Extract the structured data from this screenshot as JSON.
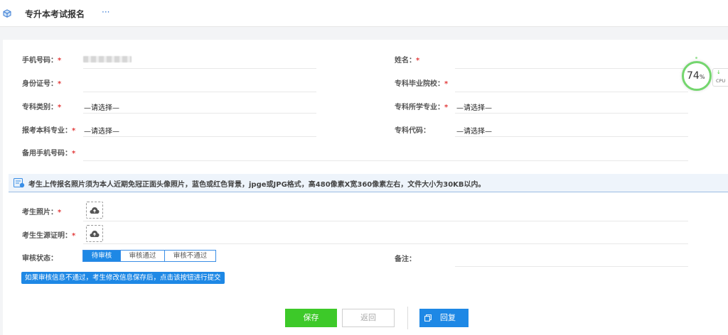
{
  "header": {
    "title": "专升本考试报名",
    "more_label": "···",
    "app_icon": "cube-icon"
  },
  "form": {
    "phone": {
      "label": "手机号码：",
      "required": "*"
    },
    "name": {
      "label": "姓名：",
      "required": "*",
      "value": ""
    },
    "id_number": {
      "label": "身份证号：",
      "required": "*",
      "value": ""
    },
    "college": {
      "label": "专科毕业院校：",
      "required": "*",
      "value": ""
    },
    "category": {
      "label": "专科类别：",
      "required": "*",
      "value": "—请选择—"
    },
    "major": {
      "label": "专科所学专业：",
      "required": "*",
      "value": "—请选择—"
    },
    "target_major": {
      "label": "报考本科专业：",
      "required": "*",
      "value": "—请选择—"
    },
    "code": {
      "label": "专科代码：",
      "value": "—请选择—"
    },
    "backup_phone": {
      "label": "备用手机号码：",
      "required": "*",
      "value": ""
    }
  },
  "notice": {
    "icon": "info-document-icon",
    "text": "考生上传报名照片须为本人近期免冠正面头像照片，蓝色或红色背景，jpge或JPG格式，高480像素X宽360像素左右，文件大小为30KB以内。"
  },
  "uploads": {
    "photo": {
      "label": "考生照片：",
      "required": "*",
      "icon": "cloud-upload-icon"
    },
    "origin": {
      "label": "考生生源证明：",
      "required": "*",
      "icon": "cloud-upload-icon"
    }
  },
  "review": {
    "label": "审核状态：",
    "options": [
      "待审核",
      "审核通过",
      "审核不通过"
    ],
    "selected": "待审核"
  },
  "remark": {
    "label": "备注：",
    "value": ""
  },
  "hint": "如果审核信息不通过，考生修改信息保存后，点击该按钮进行提交",
  "buttons": {
    "save": "保存",
    "back": "返回",
    "reply": "回复"
  },
  "cpu_widget": {
    "percent": "74",
    "unit": "%",
    "label": "CPU",
    "arrow": "↓"
  },
  "colors": {
    "primary": "#1e88e5",
    "success": "#3dc929",
    "required": "#e23b3b"
  }
}
